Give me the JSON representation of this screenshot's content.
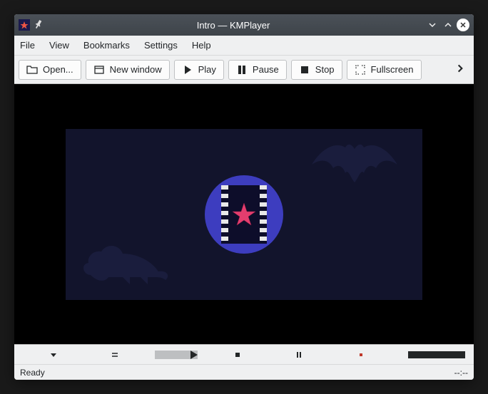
{
  "title": "Intro — KMPlayer",
  "menu": {
    "file": "File",
    "view": "View",
    "bookmarks": "Bookmarks",
    "settings": "Settings",
    "help": "Help"
  },
  "toolbar": {
    "open": "Open...",
    "new_window": "New window",
    "play": "Play",
    "pause": "Pause",
    "stop": "Stop",
    "fullscreen": "Fullscreen"
  },
  "status": {
    "left": "Ready",
    "right": "--:--"
  },
  "icons": {
    "app": "kmplayer-star",
    "pin": "pin",
    "min": "minimize",
    "max": "maximize",
    "close": "close"
  }
}
